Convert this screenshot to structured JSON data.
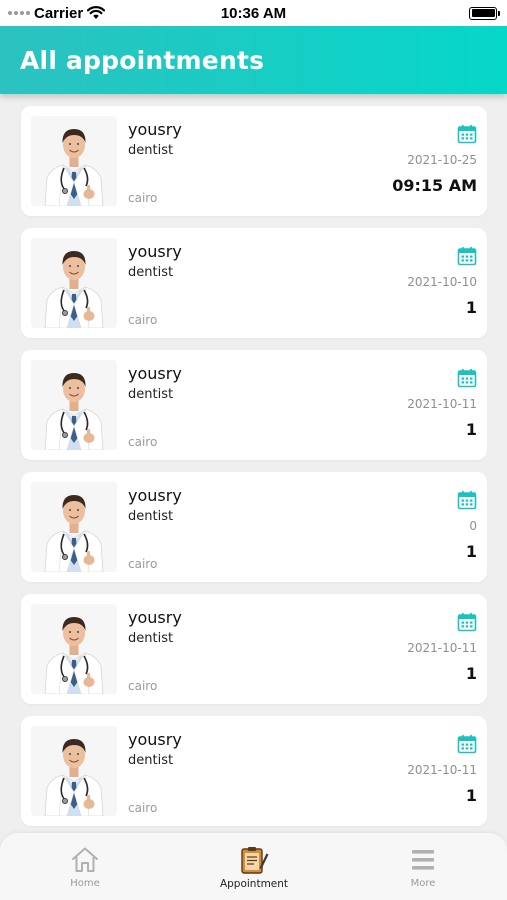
{
  "status_bar": {
    "carrier": "Carrier",
    "time": "10:36 AM"
  },
  "header": {
    "title": "All appointments"
  },
  "appointments": [
    {
      "name": "yousry",
      "specialty": "dentist",
      "city": "cairo",
      "date": "2021-10-25",
      "time": "09:15 AM"
    },
    {
      "name": "yousry",
      "specialty": "dentist",
      "city": "cairo",
      "date": "2021-10-10",
      "time": "1"
    },
    {
      "name": "yousry",
      "specialty": "dentist",
      "city": "cairo",
      "date": "2021-10-11",
      "time": "1"
    },
    {
      "name": "yousry",
      "specialty": "dentist",
      "city": "cairo",
      "date": "0",
      "time": "1"
    },
    {
      "name": "yousry",
      "specialty": "dentist",
      "city": "cairo",
      "date": "2021-10-11",
      "time": "1"
    },
    {
      "name": "yousry",
      "specialty": "dentist",
      "city": "cairo",
      "date": "2021-10-11",
      "time": "1"
    }
  ],
  "bottom_nav": {
    "home": {
      "label": "Home",
      "icon": "home-icon"
    },
    "appointment": {
      "label": "Appointment",
      "icon": "appointment-notepad-icon"
    },
    "more": {
      "label": "More",
      "icon": "menu-icon"
    }
  },
  "colors": {
    "accent": "#05d7c8",
    "header_start": "#2cc2c0",
    "calendar_icon": "#18c3c0"
  }
}
